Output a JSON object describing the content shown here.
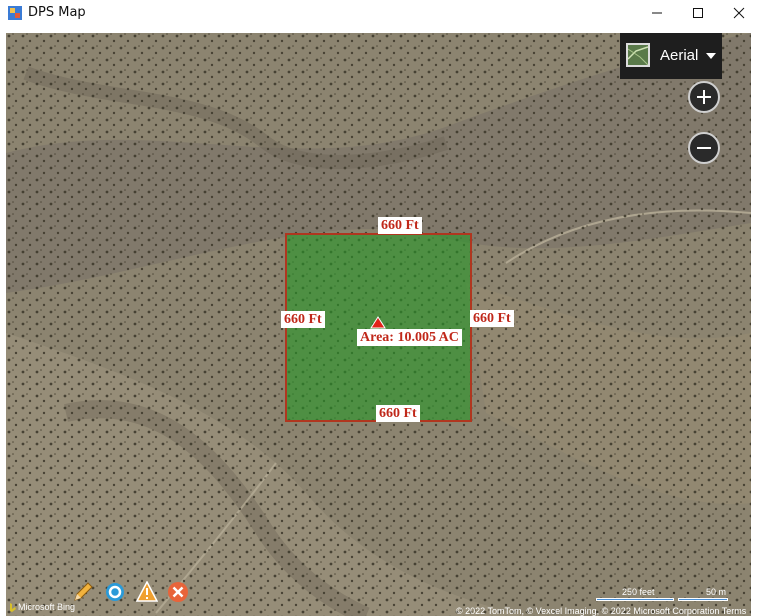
{
  "window": {
    "title": "DPS Map"
  },
  "map": {
    "style_label": "Aerial",
    "parcel": {
      "top_label": "660 Ft",
      "bottom_label": "660 Ft",
      "left_label": "660 Ft",
      "right_label": "660 Ft",
      "area_label": "Area: 10.005 AC"
    },
    "scale": {
      "feet_label": "250 feet",
      "meters_label": "50 m"
    },
    "attribution": "© 2022 TomTom, © Vexcel Imaging, © 2022 Microsoft Corporation  Terms",
    "logo_text": "Microsoft Bing"
  },
  "toolbar": {
    "icons": [
      "pencil-icon",
      "circle-icon",
      "warning-icon",
      "cancel-icon"
    ]
  },
  "colors": {
    "parcel_fill": "#289628",
    "parcel_border": "#b0361f",
    "label_text": "#c0281a",
    "picker_bg": "#1e1e1e"
  }
}
